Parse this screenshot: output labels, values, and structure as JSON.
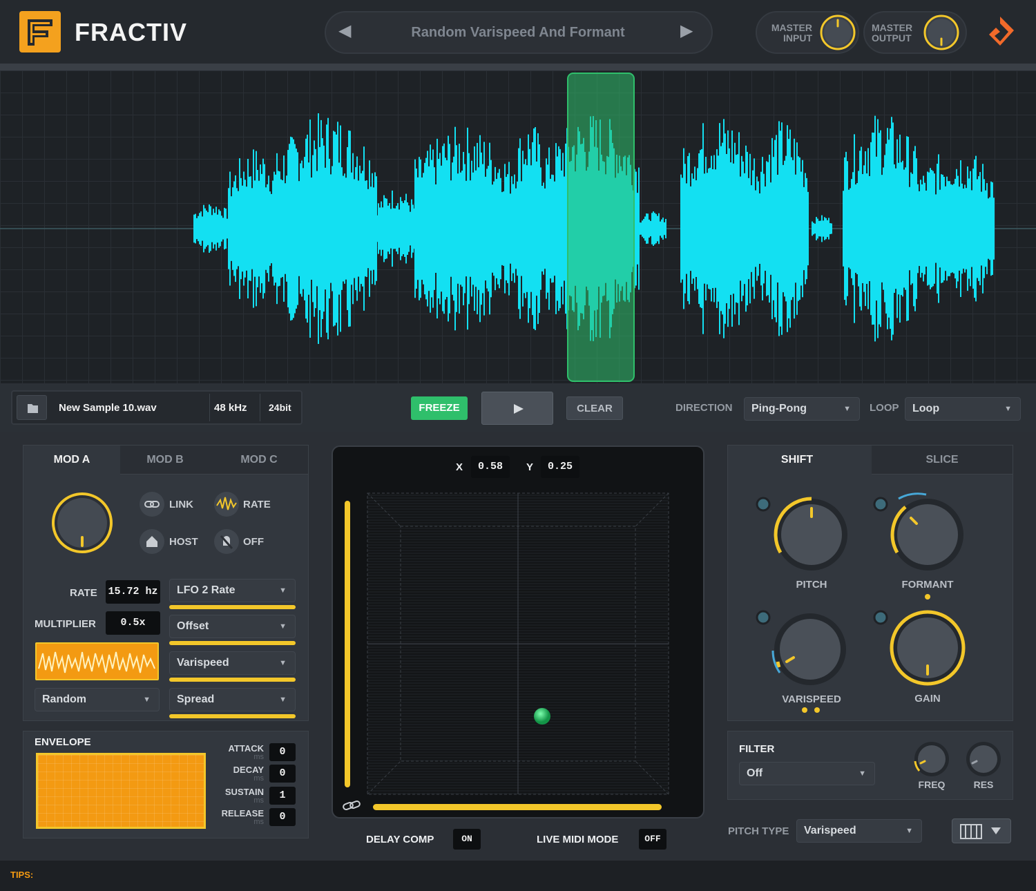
{
  "brand": {
    "name": "FRACTIV"
  },
  "preset": {
    "name": "Random Varispeed And Formant",
    "prev_icon": "chevron-left-icon",
    "next_icon": "chevron-right-icon"
  },
  "master": {
    "input_label_1": "MASTER",
    "input_label_2": "INPUT",
    "output_label_1": "MASTER",
    "output_label_2": "OUTPUT"
  },
  "file": {
    "name": "New Sample 10.wav",
    "rate": "48 kHz",
    "bits": "24bit"
  },
  "transport": {
    "freeze": "FREEZE",
    "clear": "CLEAR",
    "direction_label": "DIRECTION",
    "direction_value": "Ping-Pong",
    "loop_label": "LOOP",
    "loop_value": "Loop"
  },
  "mod": {
    "tabs": [
      "MOD A",
      "MOD B",
      "MOD C"
    ],
    "active_tab": "MOD A",
    "link": "LINK",
    "rate_btn": "RATE",
    "host": "HOST",
    "off": "OFF",
    "rate_label": "RATE",
    "rate_value": "15.72 hz",
    "multiplier_label": "MULTIPLIER",
    "multiplier_value": "0.5x",
    "wave_shape": "Random",
    "targets": [
      "LFO 2 Rate",
      "Offset",
      "Varispeed",
      "Spread"
    ]
  },
  "envelope": {
    "title": "ENVELOPE",
    "attack_label": "ATTACK",
    "attack": "0",
    "decay_label": "DECAY",
    "decay": "0",
    "sustain_label": "SUSTAIN",
    "sustain": "1",
    "release_label": "RELEASE",
    "release": "0",
    "unit": "ms"
  },
  "xy": {
    "x_label": "X",
    "x_value": "0.58",
    "y_label": "Y",
    "y_value": "0.25"
  },
  "footer": {
    "delay_comp_label": "DELAY COMP",
    "delay_comp_value": "ON",
    "midi_label": "LIVE MIDI MODE",
    "midi_value": "OFF",
    "tips": "TIPS:"
  },
  "shift": {
    "tabs": [
      "SHIFT",
      "SLICE"
    ],
    "pitch": "PITCH",
    "formant": "FORMANT",
    "varispeed": "VARISPEED",
    "gain": "GAIN"
  },
  "filter": {
    "title": "FILTER",
    "type": "Off",
    "freq": "FREQ",
    "res": "RES"
  },
  "pitch_type": {
    "label": "PITCH TYPE",
    "value": "Varispeed"
  },
  "colors": {
    "accent": "#f3c72a",
    "waveform": "#13e0f2",
    "freeze": "#2fbf6b",
    "orange": "#f39a12"
  }
}
